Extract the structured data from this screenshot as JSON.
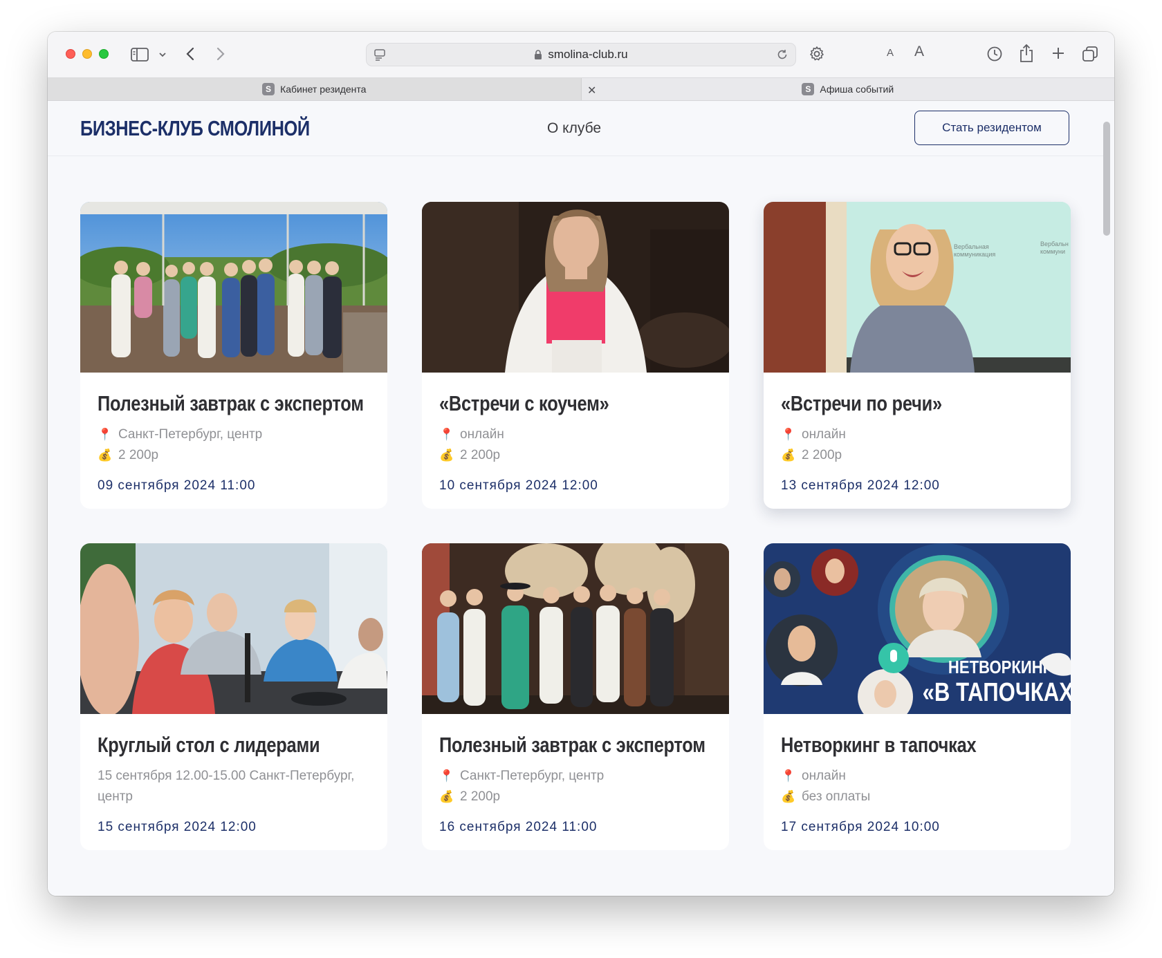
{
  "browser": {
    "url": "smolina-club.ru",
    "tabs": [
      {
        "label": "Кабинет резидента",
        "favicon": "S",
        "active": true
      },
      {
        "label": "Афиша событий",
        "favicon": "S",
        "active": false
      }
    ],
    "text_size_small": "A",
    "text_size_large": "A"
  },
  "header": {
    "logo": "БИЗНЕС-КЛУБ СМОЛИНОЙ",
    "nav_about": "О клубе",
    "cta": "Стать резидентом"
  },
  "colors": {
    "brand": "#1c2f68",
    "muted": "#8f9094",
    "title": "#2f2f33"
  },
  "events": [
    {
      "title": "Полезный завтрак с экспертом",
      "location": "Санкт-Петербург, центр",
      "price": "2 200р",
      "date": "09 сентября 2024 11:00"
    },
    {
      "title": "«Встречи с коучем»",
      "location": "онлайн",
      "price": "2 200р",
      "date": "10 сентября 2024 12:00"
    },
    {
      "title": "«Встречи по речи»",
      "location": "онлайн",
      "price": "2 200р",
      "date": "13 сентября 2024 12:00"
    },
    {
      "title": "Круглый стол с лидерами",
      "description": "15 сентября 12.00-15.00 Санкт-Петербург, центр",
      "date": "15 сентября 2024 12:00"
    },
    {
      "title": "Полезный завтрак с экспертом",
      "location": "Санкт-Петербург, центр",
      "price": "2 200р",
      "date": "16 сентября 2024 11:00"
    },
    {
      "title": "Нетворкинг в тапочках",
      "location": "онлайн",
      "price": "без оплаты",
      "date": "17 сентября 2024 10:00"
    }
  ],
  "banner": {
    "line1": "НЕТВОРКИНГ",
    "line2": "«В ТАПОЧКАХ»"
  },
  "slide": {
    "line1": "Вербальная",
    "line2": "коммуникация",
    "right1": "Вербальн",
    "right2": "коммуни"
  },
  "icons": {
    "location": "📍",
    "price": "💰"
  }
}
